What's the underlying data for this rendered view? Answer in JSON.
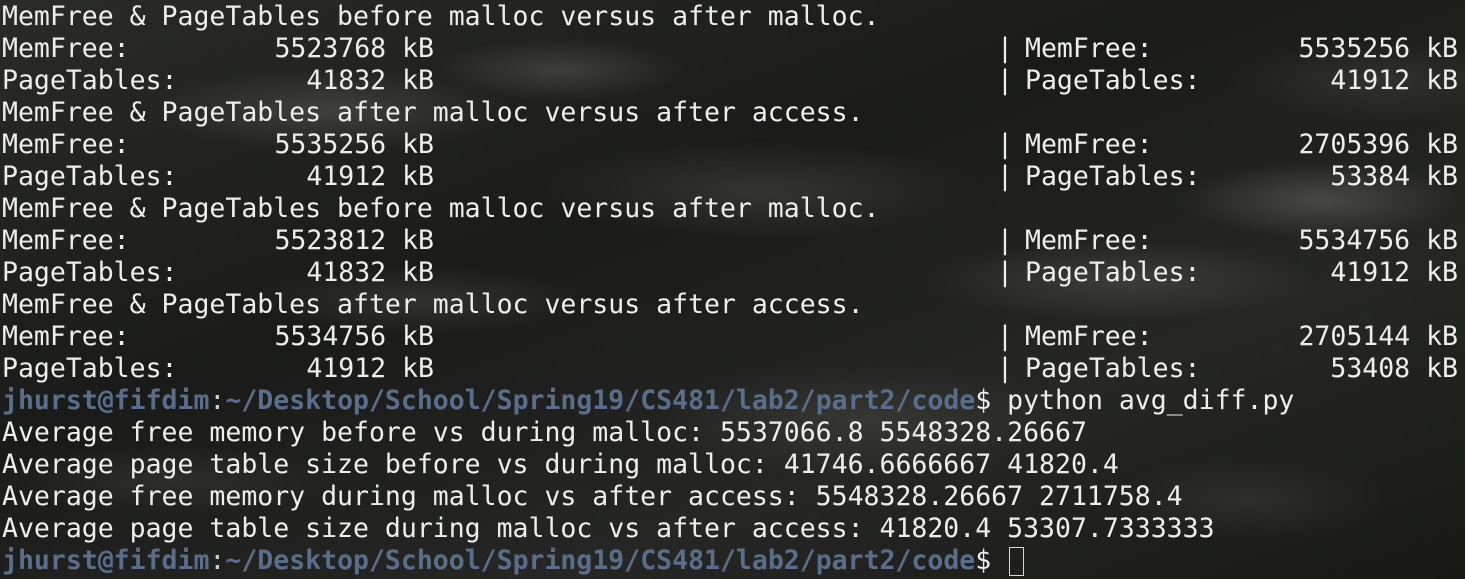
{
  "terminal": {
    "sections": [
      {
        "header": "MemFree & PageTables before malloc versus after malloc.",
        "rows": [
          {
            "label": "MemFree:",
            "left": "5523768 kB",
            "sep": "|",
            "right_label": "MemFree:",
            "right": "5535256 kB"
          },
          {
            "label": "PageTables:",
            "left": "41832 kB",
            "sep": "|",
            "right_label": "PageTables:",
            "right": "41912 kB"
          }
        ]
      },
      {
        "header": "MemFree & PageTables after malloc versus after access.",
        "rows": [
          {
            "label": "MemFree:",
            "left": "5535256 kB",
            "sep": "|",
            "right_label": "MemFree:",
            "right": "2705396 kB"
          },
          {
            "label": "PageTables:",
            "left": "41912 kB",
            "sep": "|",
            "right_label": "PageTables:",
            "right": "53384 kB"
          }
        ]
      },
      {
        "header": "MemFree & PageTables before malloc versus after malloc.",
        "rows": [
          {
            "label": "MemFree:",
            "left": "5523812 kB",
            "sep": "|",
            "right_label": "MemFree:",
            "right": "5534756 kB"
          },
          {
            "label": "PageTables:",
            "left": "41832 kB",
            "sep": "|",
            "right_label": "PageTables:",
            "right": "41912 kB"
          }
        ]
      },
      {
        "header": "MemFree & PageTables after malloc versus after access.",
        "rows": [
          {
            "label": "MemFree:",
            "left": "5534756 kB",
            "sep": "|",
            "right_label": "MemFree:",
            "right": "2705144 kB"
          },
          {
            "label": "PageTables:",
            "left": "41912 kB",
            "sep": "|",
            "right_label": "PageTables:",
            "right": "53408 kB"
          }
        ]
      }
    ],
    "prompt": {
      "user_host": "jhurst@fifdim",
      "colon": ":",
      "path": "~/Desktop/School/Spring19/CS481/lab2/part2/code",
      "dollar": "$ ",
      "command": "python avg_diff.py"
    },
    "output": [
      "Average free memory before vs during malloc: 5537066.8 5548328.26667",
      "Average page table size before vs during malloc: 41746.6666667 41820.4",
      "Average free memory during malloc vs after access: 5548328.26667 2711758.4",
      "Average page table size during malloc vs after access: 41820.4 53307.7333333"
    ],
    "final_prompt": {
      "user_host": "jhurst@fifdim",
      "colon": ":",
      "path": "~/Desktop/School/Spring19/CS481/lab2/part2/code",
      "dollar": "$ "
    }
  }
}
